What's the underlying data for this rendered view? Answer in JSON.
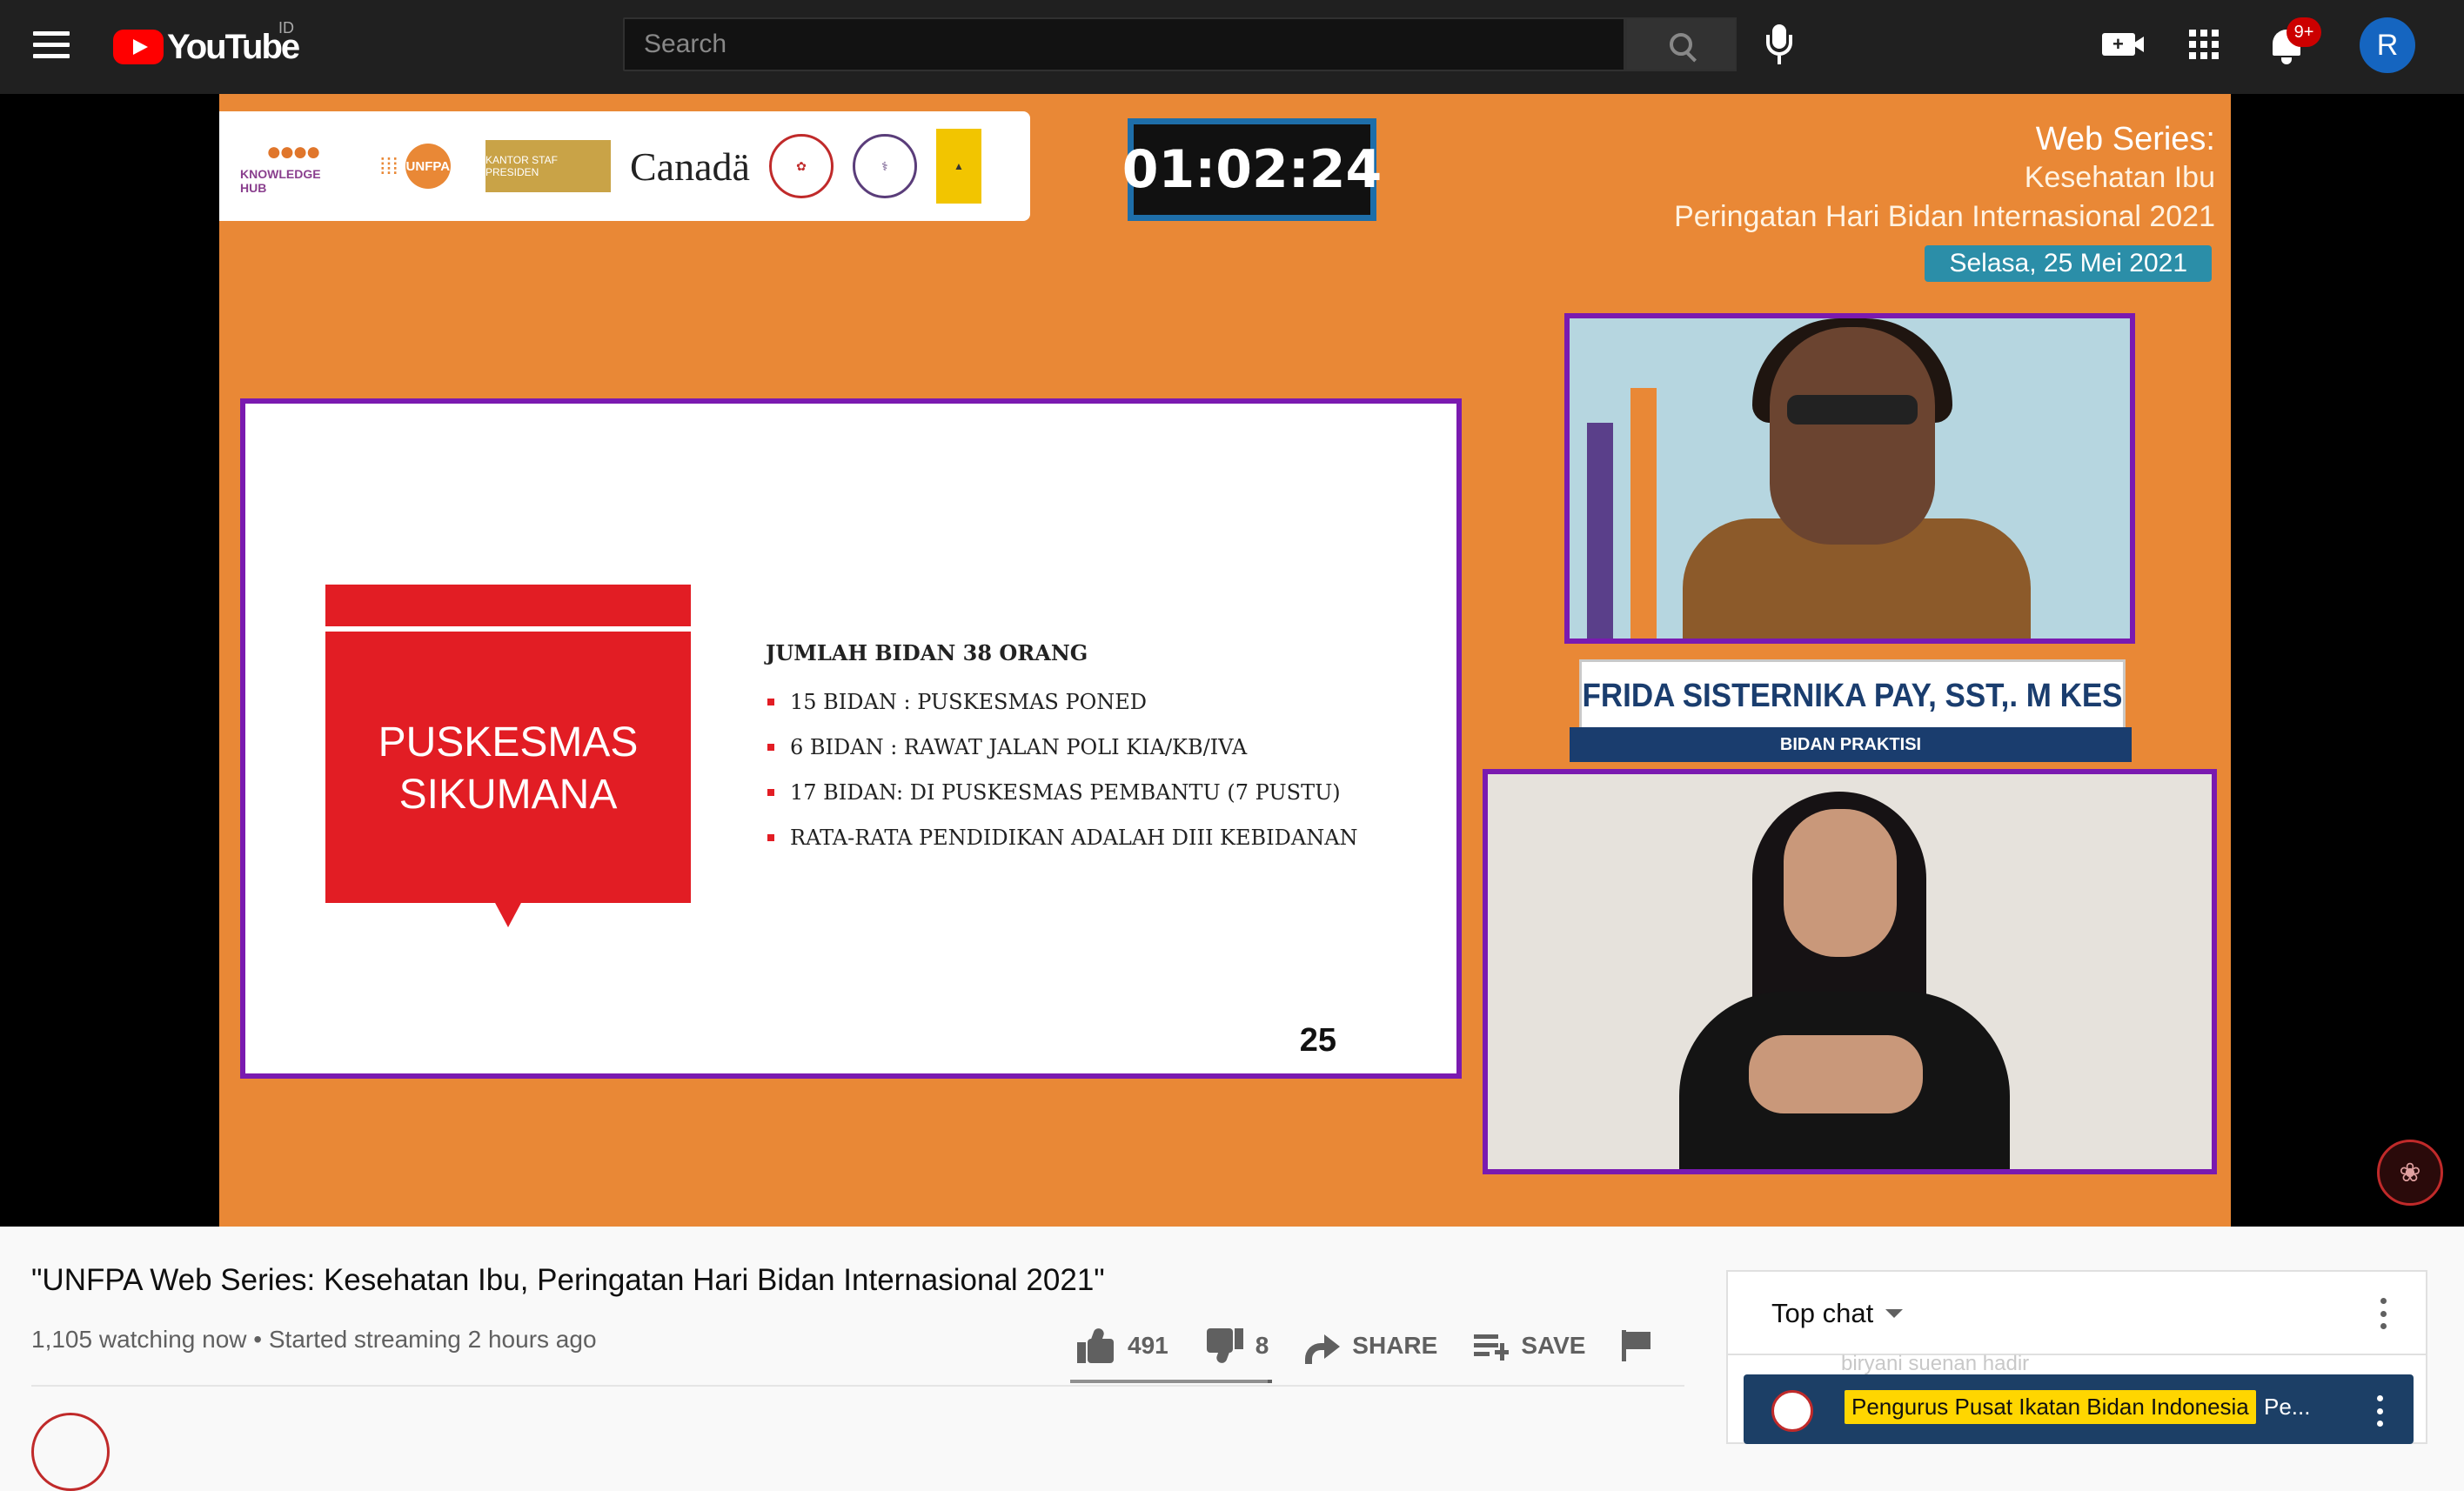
{
  "masthead": {
    "logo_text": "YouTube",
    "region": "ID",
    "search_placeholder": "Search",
    "notification_count": "9+",
    "avatar_letter": "R",
    "icons": [
      "menu-icon",
      "search-icon",
      "mic-icon",
      "create-video-icon",
      "apps-icon",
      "bell-icon"
    ]
  },
  "video": {
    "logos_banner": {
      "knowledge_hub": "KNOWLEDGE HUB",
      "unfpa": "UNFPA",
      "ksp": "KANTOR STAF PRESIDEN",
      "canada": "Canadä"
    },
    "timer": "01:02:24",
    "series": {
      "line1": "Web Series:",
      "line2": "Kesehatan Ibu",
      "line3": "Peringatan Hari Bidan Internasional 2021",
      "date": "Selasa, 25 Mei 2021"
    },
    "slide": {
      "box_title": "PUSKESMAS SIKUMANA",
      "heading": "JUMLAH BIDAN 38 ORANG",
      "items": [
        "15 BIDAN : PUSKESMAS PONED",
        "6 BIDAN :  RAWAT JALAN POLI KIA/KB/IVA",
        "17 BIDAN: DI PUSKESMAS PEMBANTU (7 PUSTU)",
        "RATA-RATA PENDIDIKAN ADALAH DIII KEBIDANAN"
      ],
      "page_number": "25"
    },
    "speaker": {
      "name": "FRIDA SISTERNIKA PAY, SST,. M KES",
      "role": "BIDAN PRAKTISI"
    }
  },
  "info": {
    "title": "\"UNFPA Web Series: Kesehatan Ibu, Peringatan Hari Bidan Internasional 2021\"",
    "views": "1,105 watching now • Started streaming 2 hours ago",
    "likes": "491",
    "dislikes": "8",
    "share_label": "SHARE",
    "save_label": "SAVE",
    "like_ratio": 0.98
  },
  "chat": {
    "mode": "Top chat",
    "faded_message": "biryani suenan  hadir",
    "pinned_author": "Pengurus Pusat Ikatan Bidan Indonesia",
    "pinned_message": "Pe..."
  },
  "colors": {
    "masthead_bg": "#202020",
    "video_bg": "#e98836",
    "slide_border": "#7a1ab0",
    "slide_red": "#e21d24",
    "date_pill": "#2b8ea8",
    "pinned_bg": "#1c3f66",
    "pinned_name_bg": "#ffd600"
  }
}
